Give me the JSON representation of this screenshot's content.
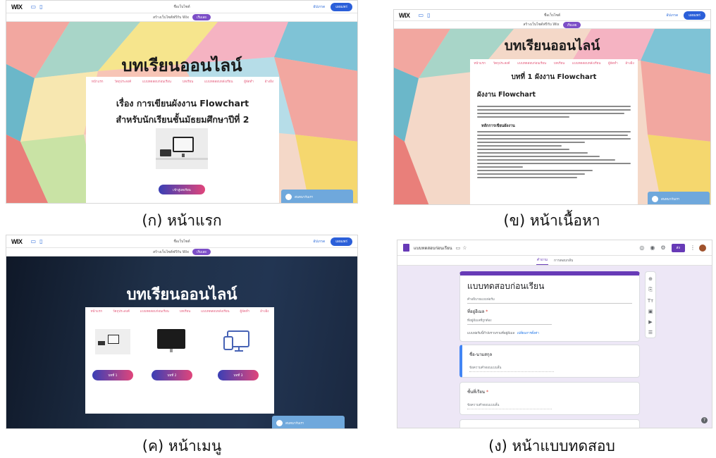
{
  "captions": {
    "a": "(ก) หน้าแรก",
    "b": "(ข) หน้าเนื้อหา",
    "c": "(ค) หน้าเมนู",
    "d": "(ง) หน้าแบบทดสอบ"
  },
  "wix": {
    "logo": "WIX",
    "site_name": "ชื่อเว็บไซต์",
    "upgrade": "อัปเกรด",
    "publish": "เผยแพร่",
    "promo_text": "สร้างเว็บไซต์ฟรีกับ Wix",
    "promo_button": "เริ่มเลย"
  },
  "site": {
    "title": "บทเรียนออนไลน์",
    "menu_a": [
      "หน้าแรก",
      "วัตถุประสงค์",
      "แบบทดสอบก่อนเรียน",
      "บทเรียน",
      "แบบทดสอบหลังเรียน",
      "ผู้จัดทำ",
      "อ้างอิง"
    ],
    "menu_c": [
      "หน้าแรก",
      "วัตถุประสงค์",
      "แบบทดสอบก่อนเรียน",
      "บทเรียน",
      "แบบทดสอบหลังเรียน",
      "ผู้จัดทำ",
      "อ้างอิง"
    ],
    "hero_line1": "เรื่อง การเขียนผังงาน Flowchart",
    "hero_line2": "สำหรับนักเรียนชั้นมัธยมศึกษาปีที่ 2",
    "enter_button": "เข้าสู่บทเรียน",
    "chat_label": "สนทนากับเรา"
  },
  "content": {
    "lesson_title": "บทที่ 1 ผังงาน Flowchart",
    "section_title": "ผังงาน Flowchart",
    "sub_heading": "หลักการเขียนผังงาน"
  },
  "menu_page": {
    "buttons": [
      "บทที่ 1",
      "บทที่ 2",
      "บทที่ 3"
    ]
  },
  "form": {
    "doc_name": "แบบทดสอบก่อนเรียน",
    "tabs": [
      "คำถาม",
      "การตอบกลับ"
    ],
    "title": "แบบทดสอบก่อนเรียน",
    "description": "คำอธิบายแบบฟอร์ม",
    "email_label": "ที่อยู่อีเมล",
    "email_required": "*",
    "email_placeholder": "ที่อยู่อีเมลที่ถูกต้อง",
    "collect_note": "แบบฟอร์มนี้กำลังรวบรวมที่อยู่อีเมล",
    "collect_link": "เปลี่ยนการตั้งค่า",
    "q1_label": "ชื่อ-นามสกุล",
    "q1_placeholder": "ข้อความคำตอบแบบสั้น",
    "q2_label": "ชั้นที่เรียน",
    "q2_required": "*",
    "q2_placeholder": "ข้อความคำตอบแบบสั้น",
    "send_button": "ส่ง",
    "tool_icons": [
      "add-question-icon",
      "import-question-icon",
      "title-icon",
      "image-icon",
      "video-icon",
      "section-icon"
    ],
    "accent": "#673ab7",
    "bg": "#ede7f6"
  }
}
